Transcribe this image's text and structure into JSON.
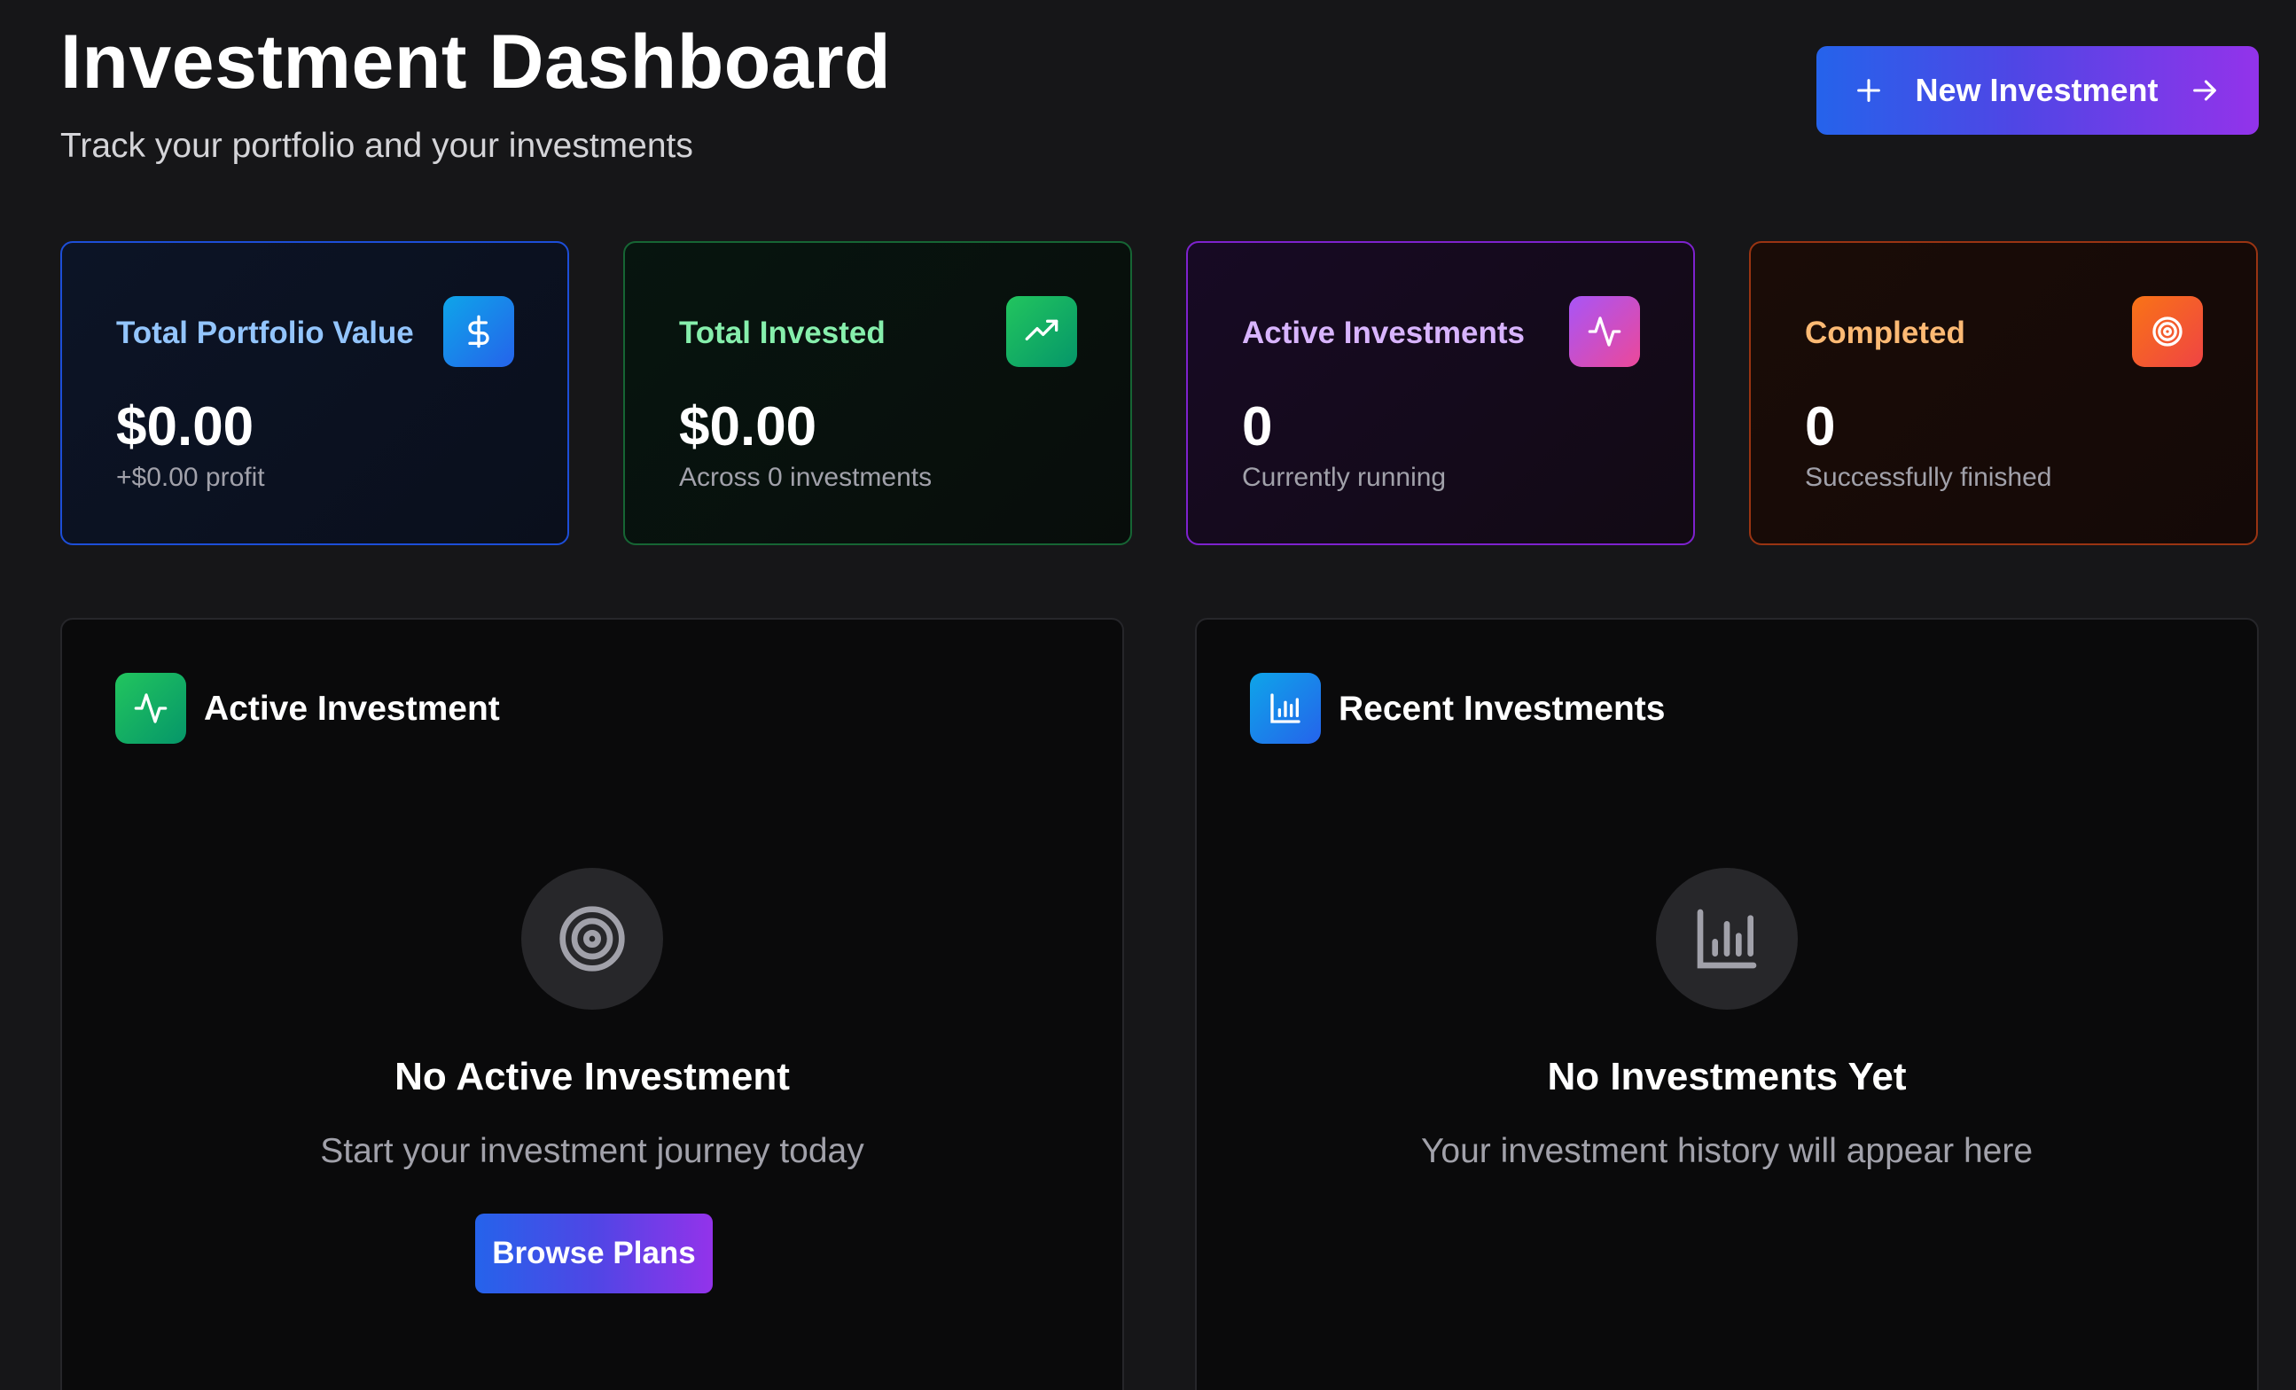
{
  "header": {
    "title": "Investment Dashboard",
    "subtitle": "Track your portfolio and your investments",
    "new_investment_label": "New Investment"
  },
  "stats": [
    {
      "label": "Total Portfolio Value",
      "value": "$0.00",
      "sub": "+$0.00 profit",
      "icon": "dollar-icon",
      "accent": "#3b82f6"
    },
    {
      "label": "Total Invested",
      "value": "$0.00",
      "sub": "Across 0 investments",
      "icon": "trending-up-icon",
      "accent": "#22c55e"
    },
    {
      "label": "Active Investments",
      "value": "0",
      "sub": "Currently running",
      "icon": "activity-icon",
      "accent": "#a855f7"
    },
    {
      "label": "Completed",
      "value": "0",
      "sub": "Successfully finished",
      "icon": "target-icon",
      "accent": "#f97316"
    }
  ],
  "active_panel": {
    "title": "Active Investment",
    "icon": "activity-icon",
    "empty_icon": "target-icon",
    "empty_title": "No Active Investment",
    "empty_desc": "Start your investment journey today",
    "button_label": "Browse Plans"
  },
  "recent_panel": {
    "title": "Recent Investments",
    "icon": "bar-chart-icon",
    "empty_icon": "bar-chart-icon",
    "empty_title": "No Investments Yet",
    "empty_desc": "Your investment history will appear here"
  }
}
